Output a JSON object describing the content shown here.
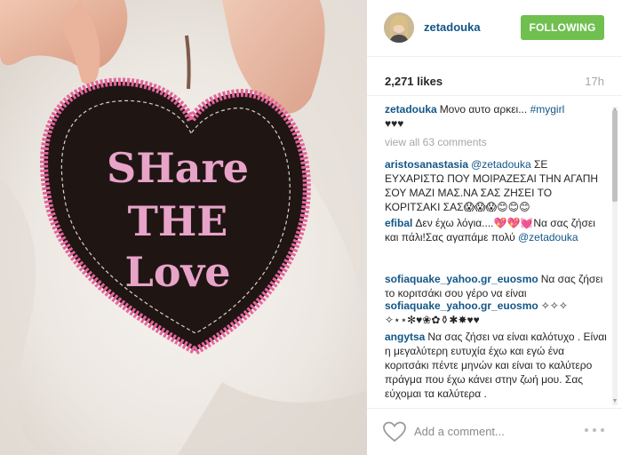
{
  "post": {
    "username": "zetadouka",
    "follow_label": "FOLLOWING",
    "likes": "2,271 likes",
    "time": "17h",
    "photo": {
      "text_line1": "SHare",
      "text_line2": "THE",
      "text_line3": "Love"
    },
    "caption": {
      "author": "zetadouka",
      "text": "Μονο αυτο αρκει... ",
      "hashtag": "#mygirl",
      "hearts": "♥♥♥"
    },
    "view_all": "view all 63 comments",
    "add_comment_placeholder": "Add a comment..."
  },
  "comments": [
    {
      "author": "aristosanastasia",
      "mention": "@zetadouka",
      "text": " ΣΕ ΕΥΧΑΡΙΣΤΩ ΠΟΥ ΜΟΙΡΑΖΕΣΑΙ ΤΗΝ ΑΓΑΠΗ ΣΟΥ ΜΑΖΙ ΜΑΣ.ΝΑ ΣΑΣ ΖΗΣΕΙ ΤΟ ΚΟΡΙΤΣΑΚΙ ΣΑΣ😱😱😱😊😊😊"
    },
    {
      "author": "efibal",
      "text": "Δεν έχω λόγια....💖💖💓Να σας ζήσει και πάλι!Σας αγαπάμε πολύ ",
      "mention": "@zetadouka"
    },
    {
      "author": "sofiaquake_yahoo.gr_euosmo",
      "text": "Να σας ζήσει το κοριτσάκι σου γέρο να είναι"
    },
    {
      "author": "sofiaquake_yahoo.gr_euosmo",
      "text": "✧✧✧ ✧⋆⋆✻♥❀✿⚱✱✸♥♥"
    },
    {
      "author": "angytsa",
      "text": "Να σας ζήσει να είναι καλότυχο . Είναι η μεγαλύτερη ευτυχία έχω και εγώ ένα κοριτσάκι πέντε μηνών και είναι το καλύτερο πράγμα που έχω κάνει στην ζωή μου. Σας εύχομαι τα καλύτερα ."
    }
  ],
  "colors": {
    "follow_button": "#70c050",
    "username": "#125688",
    "patch_pink": "#e4659b",
    "patch_dark": "#1f1614"
  },
  "icons": {
    "like": "heart-outline-icon",
    "more": "more-dots-icon"
  }
}
